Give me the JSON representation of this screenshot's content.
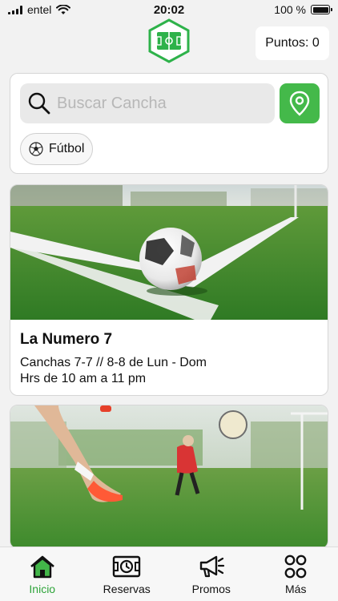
{
  "status_bar": {
    "carrier": "entel",
    "time": "20:02",
    "battery": "100 %",
    "battery_level": 1.0
  },
  "header": {
    "points_label": "Puntos: 0"
  },
  "search": {
    "placeholder": "Buscar Cancha",
    "value": ""
  },
  "filter": {
    "sport_label": "Fútbol"
  },
  "venues": [
    {
      "name": "La Numero 7",
      "details": "Canchas 7-7 // 8-8  de Lun - Dom",
      "hours": "Hrs de 10 am a 11 pm"
    },
    {
      "name": "",
      "details": "",
      "hours": ""
    }
  ],
  "tabs": [
    {
      "label": "Inicio",
      "icon": "home-icon",
      "active": true
    },
    {
      "label": "Reservas",
      "icon": "field-clock-icon",
      "active": false
    },
    {
      "label": "Promos",
      "icon": "megaphone-icon",
      "active": false
    },
    {
      "label": "Más",
      "icon": "more-circles-icon",
      "active": false
    }
  ],
  "colors": {
    "accent": "#44b94a",
    "active_tab": "#2ea43a",
    "background": "#f2f2f2"
  }
}
